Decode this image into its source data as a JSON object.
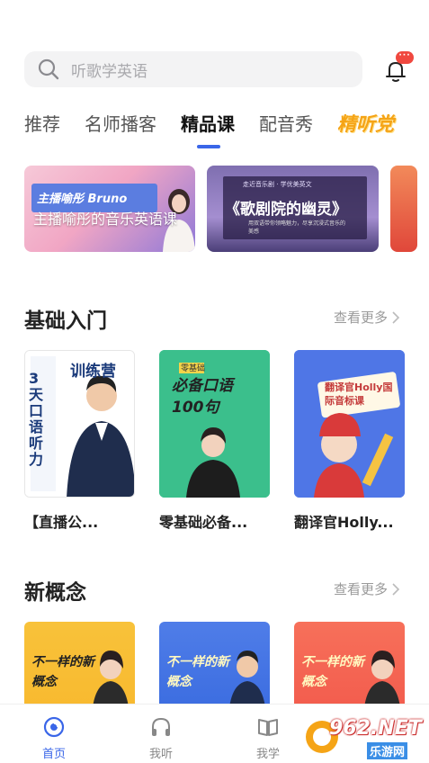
{
  "search": {
    "placeholder": "听歌学英语"
  },
  "notification": {
    "badge": "···"
  },
  "tabs": [
    {
      "label": "推荐"
    },
    {
      "label": "名师播客"
    },
    {
      "label": "精品课"
    },
    {
      "label": "配音秀"
    },
    {
      "label": "精听党"
    }
  ],
  "banners": [
    {
      "card_text": "主播喻彤 Bruno",
      "caption": "主播喻彤的音乐英语课"
    },
    {
      "top_text": "走近音乐剧 · 学优美英文",
      "title": "《歌剧院的幽灵》",
      "bottom_text": "用双语带你领略魅力，尽享沉浸式音乐的美感"
    },
    {
      "text": "..."
    }
  ],
  "sections": [
    {
      "title": "基础入门",
      "more_label": "查看更多",
      "courses": [
        {
          "label": "【直播公...",
          "cover_text": "训练营",
          "cover_big": "3天口语听力"
        },
        {
          "label": "零基础必备...",
          "cover_tag": "零基础",
          "cover_text": "必备口语100句"
        },
        {
          "label": "翻译官Holly...",
          "cover_text": "翻译官Holly国际音标课"
        }
      ]
    },
    {
      "title": "新概念",
      "more_label": "查看更多",
      "courses": [
        {
          "cover_text": "不一样的新概念"
        },
        {
          "cover_text": "不一样的新概念"
        },
        {
          "cover_text": "不一样的新概念"
        }
      ]
    }
  ],
  "nav": [
    {
      "label": "首页",
      "icon": "home-icon"
    },
    {
      "label": "我听",
      "icon": "headphones-icon"
    },
    {
      "label": "我学",
      "icon": "book-icon"
    }
  ],
  "watermark": {
    "brand": "962.NET",
    "sub": "乐游网"
  },
  "colors": {
    "accent": "#3a66e8",
    "special_tab": "#f5a416",
    "badge": "#f0483f"
  }
}
